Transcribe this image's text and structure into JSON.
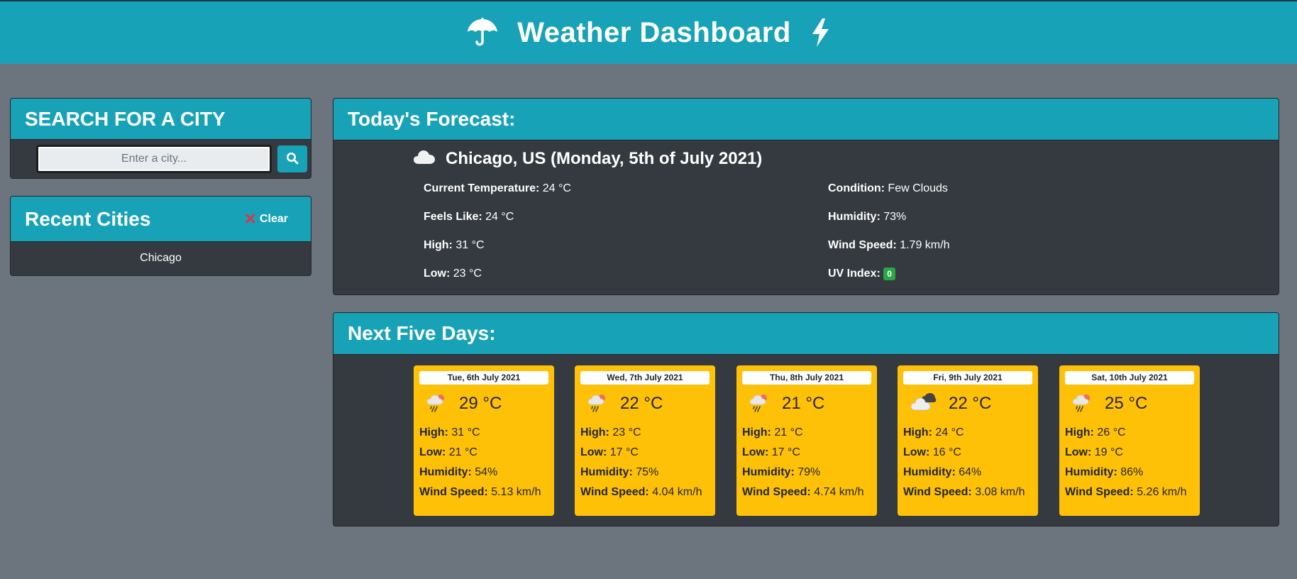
{
  "header": {
    "title": "Weather Dashboard",
    "left_icon": "umbrella-icon",
    "right_icon": "bolt-icon"
  },
  "search": {
    "title": "SEARCH FOR A CITY",
    "placeholder": "Enter a city...",
    "button_icon": "search-icon"
  },
  "recent": {
    "title": "Recent Cities",
    "clear_label": "Clear",
    "clear_icon": "x",
    "items": [
      "Chicago"
    ]
  },
  "today": {
    "title": "Today's Forecast:",
    "location": "Chicago, US (Monday, 5th of July 2021)",
    "icon": "cloud-icon",
    "current_temp_label": "Current Temperature:",
    "current_temp": "24 °C",
    "feels_like_label": "Feels Like:",
    "feels_like": "24 °C",
    "high_label": "High:",
    "high": "31 °C",
    "low_label": "Low:",
    "low": "23 °C",
    "condition_label": "Condition:",
    "condition": "Few Clouds",
    "humidity_label": "Humidity:",
    "humidity": "73%",
    "wind_label": "Wind Speed:",
    "wind": "1.79 km/h",
    "uv_label": "UV Index:",
    "uv": "0",
    "uv_color": "#28a745"
  },
  "five_day": {
    "title": "Next Five Days:",
    "labels": {
      "high": "High:",
      "low": "Low:",
      "humidity": "Humidity:",
      "wind": "Wind Speed:"
    },
    "days": [
      {
        "date": "Tue, 6th July 2021",
        "icon": "rain-cloud-sun-icon",
        "temp": "29 °C",
        "high": "31 °C",
        "low": "21 °C",
        "humidity": "54%",
        "wind": "5.13 km/h"
      },
      {
        "date": "Wed, 7th July 2021",
        "icon": "rain-cloud-sun-icon",
        "temp": "22 °C",
        "high": "23 °C",
        "low": "17 °C",
        "humidity": "75%",
        "wind": "4.04 km/h"
      },
      {
        "date": "Thu, 8th July 2021",
        "icon": "rain-cloud-sun-icon",
        "temp": "21 °C",
        "high": "21 °C",
        "low": "17 °C",
        "humidity": "79%",
        "wind": "4.74 km/h"
      },
      {
        "date": "Fri, 9th July 2021",
        "icon": "broken-clouds-icon",
        "temp": "22 °C",
        "high": "24 °C",
        "low": "16 °C",
        "humidity": "64%",
        "wind": "3.08 km/h"
      },
      {
        "date": "Sat, 10th July 2021",
        "icon": "rain-cloud-sun-icon",
        "temp": "25 °C",
        "high": "26 °C",
        "low": "19 °C",
        "humidity": "86%",
        "wind": "5.26 km/h"
      }
    ]
  },
  "colors": {
    "accent": "#17a2b8",
    "panel": "#343a40",
    "background": "#6c757d",
    "forecast_card": "#ffc107",
    "clear_x": "#dc3545"
  }
}
